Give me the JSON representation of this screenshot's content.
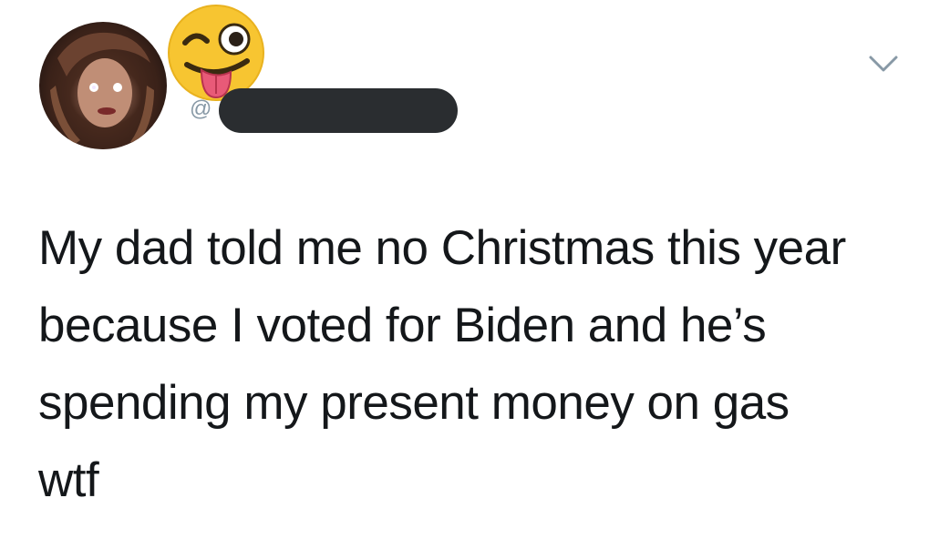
{
  "tweet": {
    "handle_prefix": "@",
    "text_lines": [
      "My dad told me no Christmas this year",
      "because I voted for Biden and he’s",
      "spending my present money on gas",
      "wtf"
    ]
  },
  "icons": {
    "avatar": "profile-photo",
    "emoji": "winking-face-with-tongue",
    "menu": "chevron-down-icon"
  },
  "colors": {
    "text": "#14171a",
    "muted": "#8899a6",
    "redaction": "#2a2d30",
    "emoji_face": "#f7c531"
  }
}
